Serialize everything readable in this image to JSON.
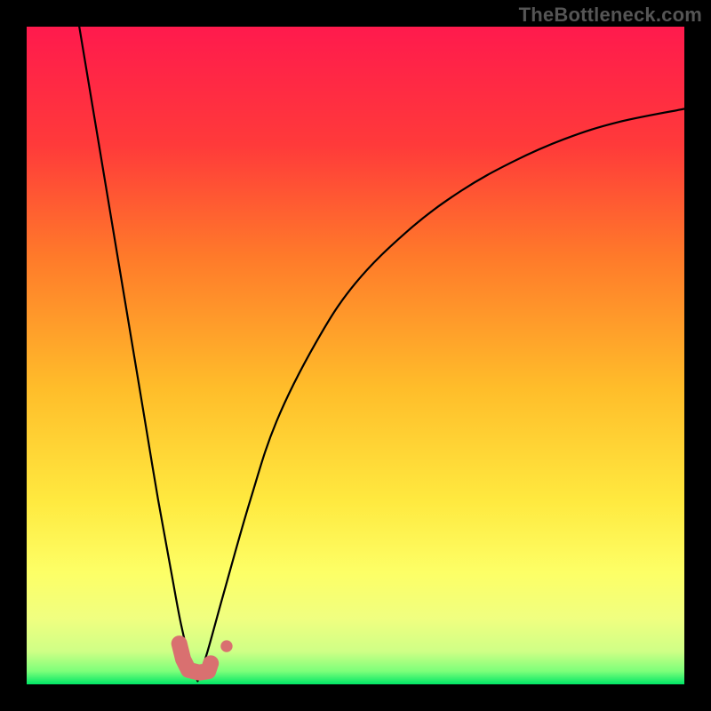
{
  "watermark": "TheBottleneck.com",
  "chart_data": {
    "type": "line",
    "title": "",
    "xlabel": "",
    "ylabel": "",
    "xlim": [
      0,
      100
    ],
    "ylim": [
      0,
      100
    ],
    "grid": false,
    "legend": false,
    "background_gradient": {
      "top_color": "#ff1a4d",
      "mid_colors": [
        "#ff6a2a",
        "#ffd22a",
        "#fff24d",
        "#f3ff73"
      ],
      "bottom_color": "#00e666"
    },
    "series": [
      {
        "name": "left-branch",
        "stroke": "#000000",
        "points": [
          {
            "x": 8.0,
            "y": 100.0
          },
          {
            "x": 10.0,
            "y": 88.0
          },
          {
            "x": 12.0,
            "y": 76.0
          },
          {
            "x": 14.0,
            "y": 64.0
          },
          {
            "x": 16.0,
            "y": 52.0
          },
          {
            "x": 18.0,
            "y": 40.0
          },
          {
            "x": 20.0,
            "y": 28.0
          },
          {
            "x": 22.0,
            "y": 17.0
          },
          {
            "x": 23.5,
            "y": 9.0
          },
          {
            "x": 25.0,
            "y": 3.0
          },
          {
            "x": 26.0,
            "y": 0.5
          }
        ]
      },
      {
        "name": "right-branch",
        "stroke": "#000000",
        "points": [
          {
            "x": 26.0,
            "y": 0.5
          },
          {
            "x": 27.5,
            "y": 5.0
          },
          {
            "x": 30.0,
            "y": 14.0
          },
          {
            "x": 34.0,
            "y": 28.0
          },
          {
            "x": 38.0,
            "y": 40.0
          },
          {
            "x": 44.0,
            "y": 52.0
          },
          {
            "x": 50.0,
            "y": 61.0
          },
          {
            "x": 58.0,
            "y": 69.0
          },
          {
            "x": 66.0,
            "y": 75.0
          },
          {
            "x": 74.0,
            "y": 79.5
          },
          {
            "x": 82.0,
            "y": 83.0
          },
          {
            "x": 90.0,
            "y": 85.5
          },
          {
            "x": 100.0,
            "y": 87.5
          }
        ]
      }
    ],
    "markers": [
      {
        "name": "bottom-blob",
        "shape": "L-blob",
        "approx_center": {
          "x": 25.5,
          "y": 3.2
        },
        "fill": "#d97070",
        "points": [
          {
            "x": 23.2,
            "y": 6.2
          },
          {
            "x": 23.8,
            "y": 3.8
          },
          {
            "x": 24.6,
            "y": 2.2
          },
          {
            "x": 26.2,
            "y": 1.8
          },
          {
            "x": 27.6,
            "y": 2.0
          },
          {
            "x": 28.0,
            "y": 3.2
          }
        ]
      },
      {
        "name": "small-dot",
        "shape": "dot",
        "approx_center": {
          "x": 30.4,
          "y": 5.8
        },
        "fill": "#d97070",
        "radius_pct": 0.9
      }
    ]
  }
}
